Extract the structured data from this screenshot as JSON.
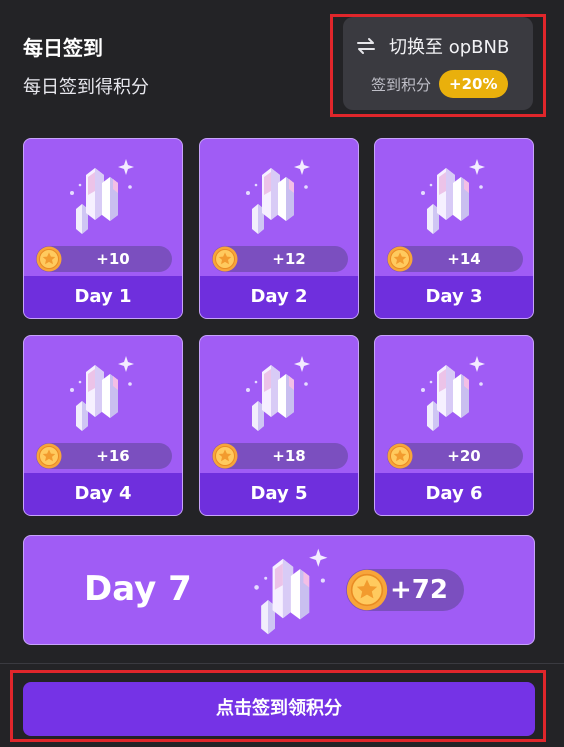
{
  "header": {
    "title": "每日签到",
    "subtitle": "每日签到得积分"
  },
  "switch_panel": {
    "label": "切换至 opBNB",
    "bonus_label": "签到积分",
    "bonus_badge": "+20%"
  },
  "days": [
    {
      "label": "Day 1",
      "reward": "+10"
    },
    {
      "label": "Day 2",
      "reward": "+12"
    },
    {
      "label": "Day 3",
      "reward": "+14"
    },
    {
      "label": "Day 4",
      "reward": "+16"
    },
    {
      "label": "Day 5",
      "reward": "+18"
    },
    {
      "label": "Day 6",
      "reward": "+20"
    },
    {
      "label": "Day 7",
      "reward": "+72"
    }
  ],
  "cta": {
    "label": "点击签到领积分"
  },
  "colors": {
    "background": "#232326",
    "card": "#a05cf5",
    "card_footer": "#6f2fdd",
    "button": "#7533e6",
    "badge": "#e9b00c",
    "highlight": "#e0262b"
  },
  "icons": {
    "switch": "swap-arrows-icon",
    "reward_art": "crystal-icon",
    "coin": "coin-icon"
  }
}
